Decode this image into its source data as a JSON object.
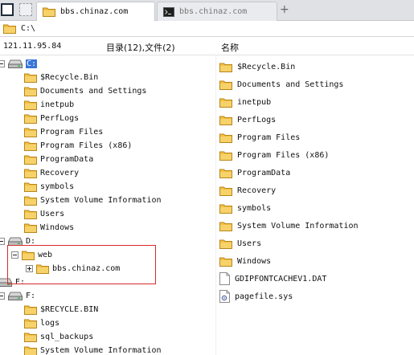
{
  "tabs": [
    {
      "label": "bbs.chinaz.com",
      "icon": "folder-icon",
      "active": true
    },
    {
      "label": "bbs.chinaz.com",
      "icon": "terminal-icon",
      "active": false
    }
  ],
  "new_tab_label": "+",
  "address": {
    "path": "C:\\"
  },
  "header": {
    "ip": "121.11.95.84",
    "count": "目录(12),文件(2)",
    "name_col": "名称"
  },
  "tree": [
    {
      "label": "C:",
      "kind": "drive",
      "depth": 0,
      "expander": "minus",
      "selected": true
    },
    {
      "label": "$Recycle.Bin",
      "kind": "folder",
      "depth": 1
    },
    {
      "label": "Documents and Settings",
      "kind": "folder",
      "depth": 1
    },
    {
      "label": "inetpub",
      "kind": "folder",
      "depth": 1
    },
    {
      "label": "PerfLogs",
      "kind": "folder",
      "depth": 1
    },
    {
      "label": "Program Files",
      "kind": "folder",
      "depth": 1
    },
    {
      "label": "Program Files (x86)",
      "kind": "folder",
      "depth": 1
    },
    {
      "label": "ProgramData",
      "kind": "folder",
      "depth": 1
    },
    {
      "label": "Recovery",
      "kind": "folder",
      "depth": 1
    },
    {
      "label": "symbols",
      "kind": "folder",
      "depth": 1
    },
    {
      "label": "System Volume Information",
      "kind": "folder",
      "depth": 1
    },
    {
      "label": "Users",
      "kind": "folder",
      "depth": 1
    },
    {
      "label": "Windows",
      "kind": "folder",
      "depth": 1
    },
    {
      "label": "D:",
      "kind": "drive",
      "depth": 0,
      "expander": "minus"
    },
    {
      "label": "web",
      "kind": "folder",
      "depth": 1,
      "expander": "minus"
    },
    {
      "label": "bbs.chinaz.com",
      "kind": "folder",
      "depth": 2,
      "expander": "plus"
    },
    {
      "label": "E:",
      "kind": "drive",
      "depth": 0
    },
    {
      "label": "F:",
      "kind": "drive",
      "depth": 0,
      "expander": "minus"
    },
    {
      "label": "$RECYCLE.BIN",
      "kind": "folder",
      "depth": 1
    },
    {
      "label": "logs",
      "kind": "folder",
      "depth": 1
    },
    {
      "label": "sql_backups",
      "kind": "folder",
      "depth": 1
    },
    {
      "label": "System Volume Information",
      "kind": "folder",
      "depth": 1
    }
  ],
  "list": [
    {
      "label": "$Recycle.Bin",
      "kind": "folder"
    },
    {
      "label": "Documents and Settings",
      "kind": "folder"
    },
    {
      "label": "inetpub",
      "kind": "folder"
    },
    {
      "label": "PerfLogs",
      "kind": "folder"
    },
    {
      "label": "Program Files",
      "kind": "folder"
    },
    {
      "label": "Program Files (x86)",
      "kind": "folder"
    },
    {
      "label": "ProgramData",
      "kind": "folder"
    },
    {
      "label": "Recovery",
      "kind": "folder"
    },
    {
      "label": "symbols",
      "kind": "folder"
    },
    {
      "label": "System Volume Information",
      "kind": "folder"
    },
    {
      "label": "Users",
      "kind": "folder"
    },
    {
      "label": "Windows",
      "kind": "folder"
    },
    {
      "label": "GDIPFONTCACHEV1.DAT",
      "kind": "file"
    },
    {
      "label": "pagefile.sys",
      "kind": "sysfile"
    }
  ],
  "colors": {
    "folder": "#f2c043",
    "folder_dark": "#d49a1e",
    "selection": "#3875d7",
    "highlight_box": "#d92b2b"
  }
}
